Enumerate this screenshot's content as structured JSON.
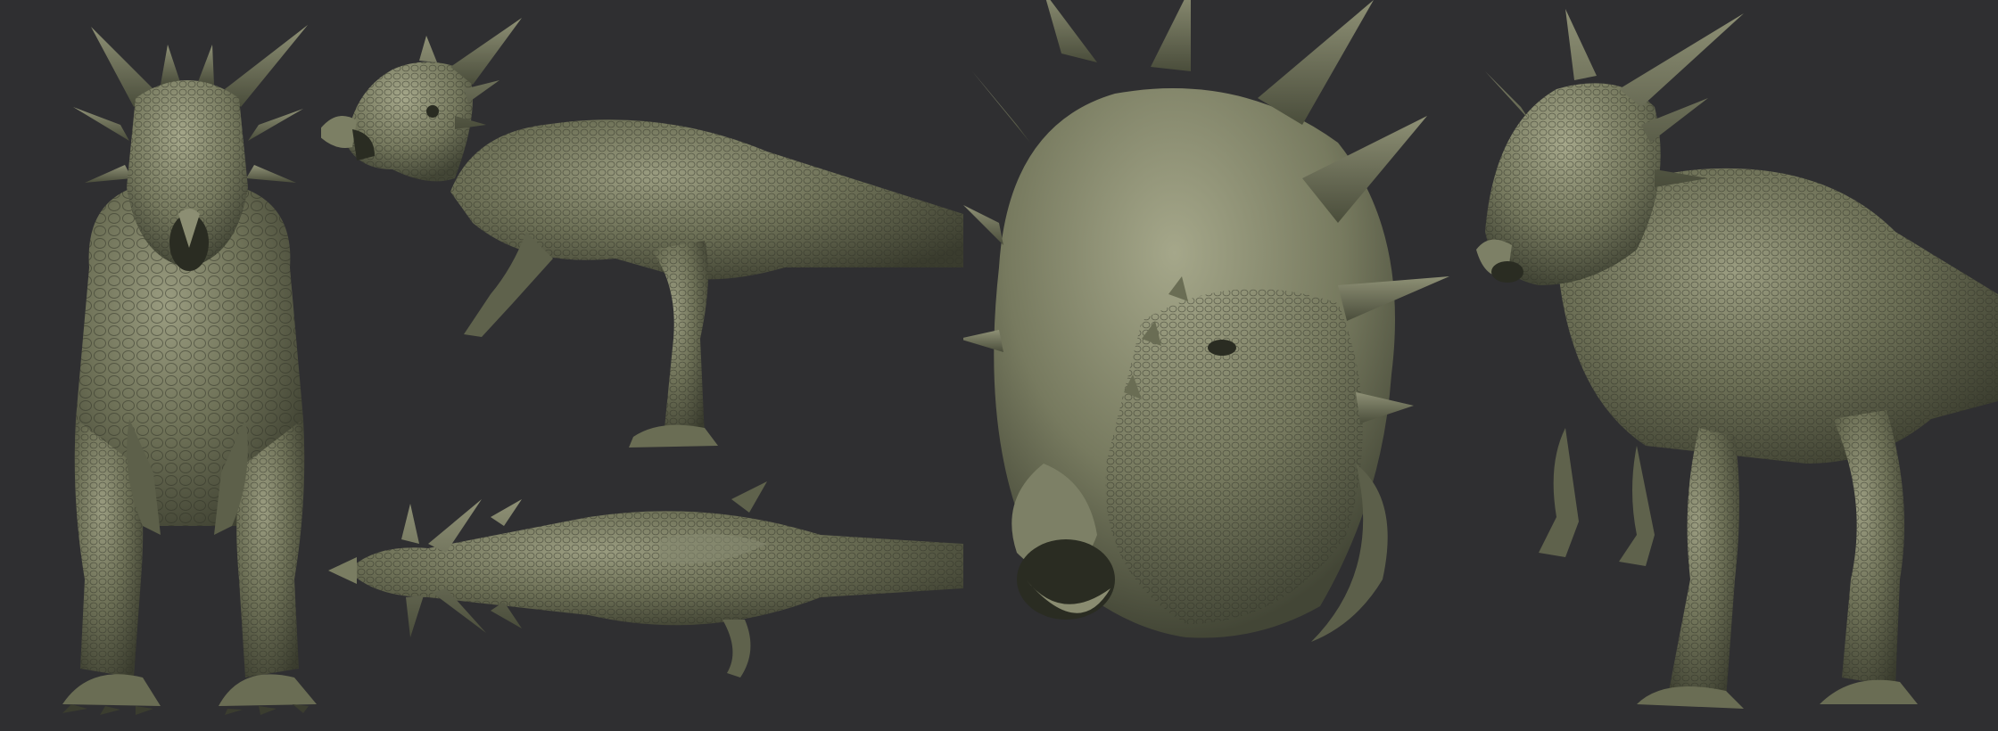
{
  "colors": {
    "background": "#2f2f31",
    "skin_light": "#8a8c72",
    "skin_mid": "#6c6f55",
    "skin_dark": "#3f4233",
    "skin_shadow": "#2a2c22"
  },
  "views": [
    {
      "id": "front",
      "icon": "dinosaur-front-view"
    },
    {
      "id": "side",
      "icon": "dinosaur-side-view"
    },
    {
      "id": "top",
      "icon": "dinosaur-top-view"
    },
    {
      "id": "head-closeup",
      "icon": "dinosaur-head-closeup"
    },
    {
      "id": "three-quarter",
      "icon": "dinosaur-three-quarter-view"
    }
  ]
}
